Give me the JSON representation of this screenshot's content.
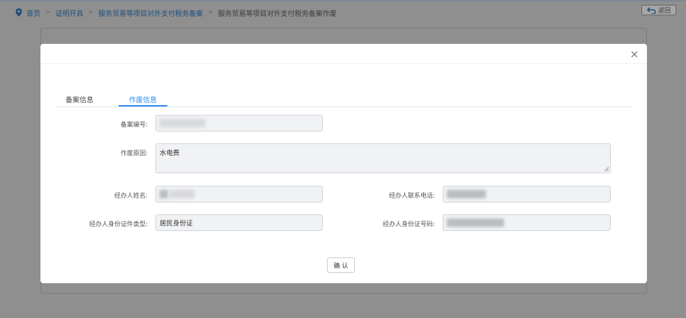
{
  "breadcrumb": {
    "home": "首页",
    "level1": "证明开具",
    "level2": "服务贸易等项目对外支付税务备案",
    "current": "服务贸易等项目对外支付税务备案作废"
  },
  "back_button": {
    "label": "返回"
  },
  "modal": {
    "tabs": [
      {
        "label": "备案信息",
        "active": false
      },
      {
        "label": "作废信息",
        "active": true
      }
    ],
    "fields": {
      "filing_no": {
        "label": "备案编号:",
        "value": ""
      },
      "void_reason": {
        "label": "作废原因:",
        "value": "水电费"
      },
      "agent_name": {
        "label": "经办人姓名:",
        "value": ""
      },
      "agent_phone": {
        "label": "经办人联系电话:",
        "value": ""
      },
      "agent_id_type": {
        "label": "经办人身份证件类型:",
        "value": "居民身份证"
      },
      "agent_id_no": {
        "label": "经办人身份证号码:",
        "value": ""
      }
    },
    "confirm_label": "确 认"
  },
  "colors": {
    "accent": "#2d8cf0",
    "overlay": "#8f8f8f",
    "link": "#1f4f7c"
  }
}
